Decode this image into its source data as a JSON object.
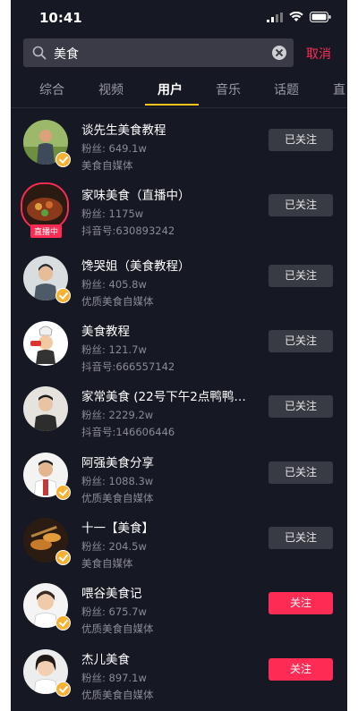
{
  "status_bar": {
    "time": "10:41"
  },
  "search": {
    "value": "美食",
    "cancel_label": "取消"
  },
  "tabs": [
    {
      "label": "综合"
    },
    {
      "label": "视频"
    },
    {
      "label": "用户"
    },
    {
      "label": "音乐"
    },
    {
      "label": "话题"
    },
    {
      "label": "直"
    }
  ],
  "active_tab": "用户",
  "colors": {
    "background": "#161823",
    "accent": "#fe2c55",
    "tab_indicator": "#f6c31d",
    "verified_badge": "#f6b235"
  },
  "users": [
    {
      "name": "谈先生美食教程",
      "fans": "粉丝: 649.1w",
      "sub": "美食自媒体",
      "button": "已关注",
      "followed": true,
      "verified": true,
      "live": false
    },
    {
      "name": "家味美食（直播中）",
      "fans": "粉丝: 1175w",
      "sub": "抖音号:630893242",
      "button": "已关注",
      "followed": true,
      "verified": false,
      "live": true,
      "live_label": "直播中"
    },
    {
      "name": "馋哭姐（美食教程）",
      "fans": "粉丝: 405.8w",
      "sub": "优质美食自媒体",
      "button": "已关注",
      "followed": true,
      "verified": true,
      "live": false
    },
    {
      "name": "美食教程",
      "fans": "粉丝: 121.7w",
      "sub": "抖音号:666557142",
      "button": "已关注",
      "followed": true,
      "verified": false,
      "live": false
    },
    {
      "name": "家常美食 (22号下午2点鸭鸭…",
      "fans": "粉丝: 2229.2w",
      "sub": "抖音号:146606446",
      "button": "已关注",
      "followed": true,
      "verified": false,
      "live": false
    },
    {
      "name": "阿强美食分享",
      "fans": "粉丝: 1088.3w",
      "sub": "优质美食自媒体",
      "button": "已关注",
      "followed": true,
      "verified": true,
      "live": false
    },
    {
      "name": "十一【美食】",
      "fans": "粉丝: 204.5w",
      "sub": "美食自媒体",
      "button": "已关注",
      "followed": true,
      "verified": true,
      "live": false
    },
    {
      "name": "喂谷美食记",
      "fans": "粉丝: 675.7w",
      "sub": "优质美食自媒体",
      "button": "关注",
      "followed": false,
      "verified": true,
      "live": false
    },
    {
      "name": "杰儿美食",
      "fans": "粉丝: 897.1w",
      "sub": "优质美食自媒体",
      "button": "关注",
      "followed": false,
      "verified": true,
      "live": false
    }
  ]
}
